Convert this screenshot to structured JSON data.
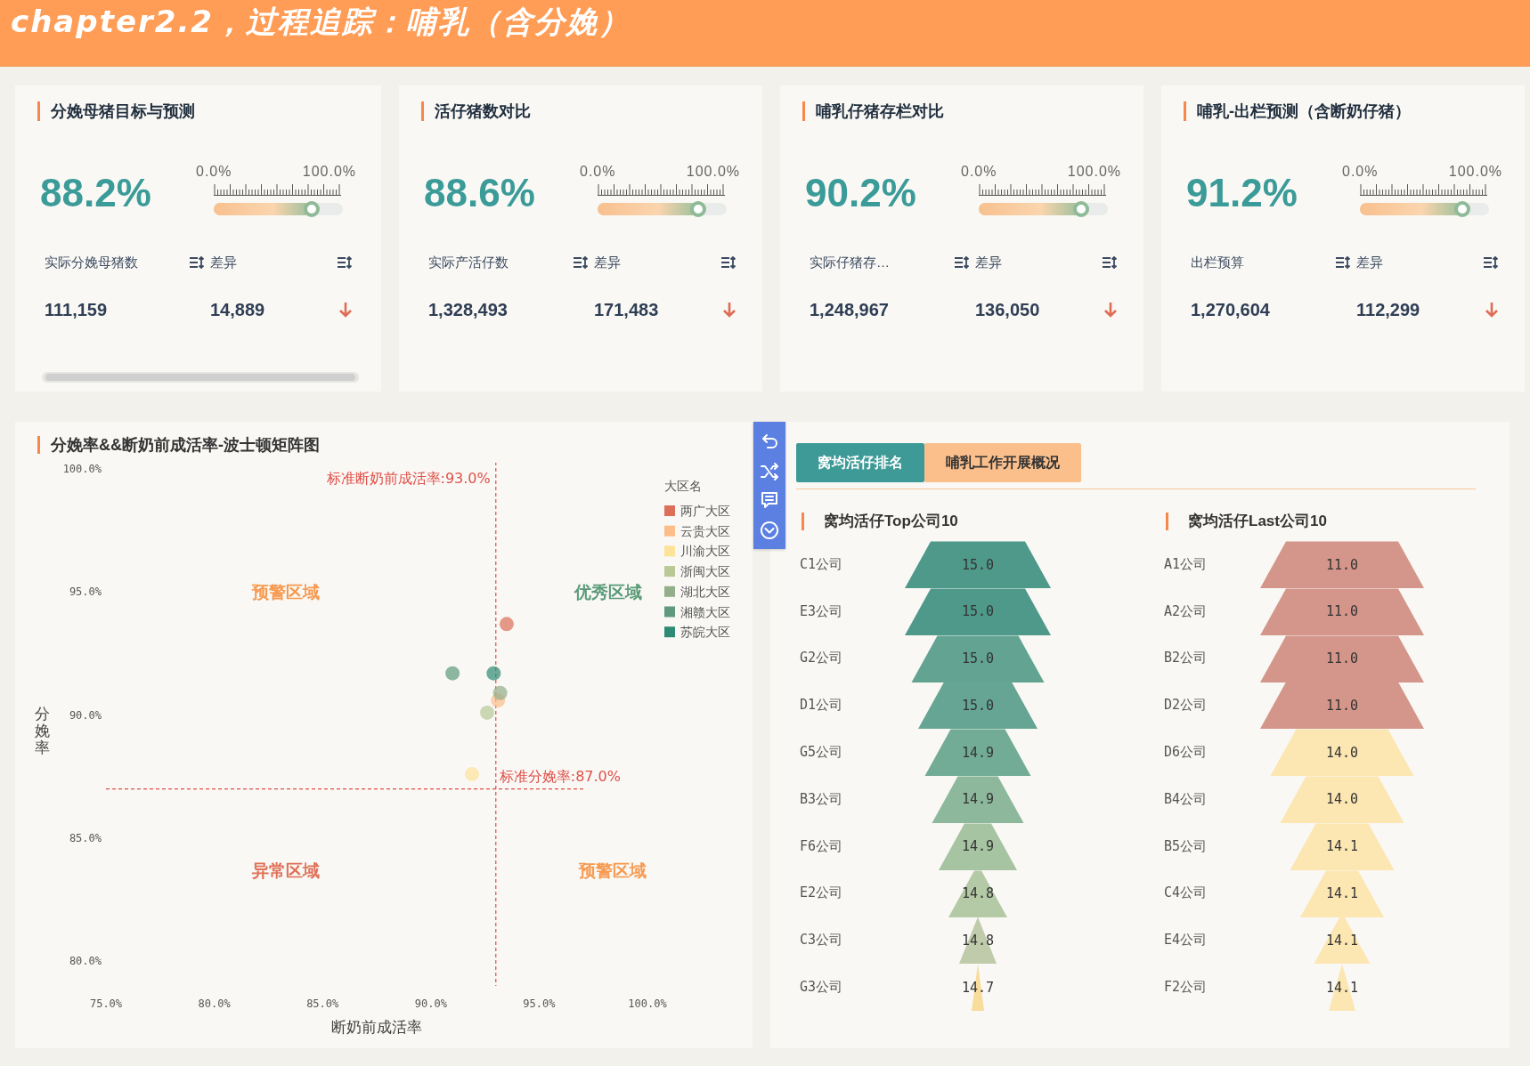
{
  "header": {
    "title": "chapter2.2，过程追踪：哺乳（含分娩）"
  },
  "kpi_cards": [
    {
      "title": "分娩母猪目标与预测",
      "rate": "88.2%",
      "slider": {
        "min_label": "0.0%",
        "max_label": "100.0%",
        "level": 0.76
      },
      "columns": [
        {
          "header": "实际分娩母猪数",
          "value": "111,159"
        },
        {
          "header": "差异",
          "value": "14,889"
        }
      ],
      "scrollbar": true
    },
    {
      "title": "活仔猪数对比",
      "rate": "88.6%",
      "slider": {
        "min_label": "0.0%",
        "max_label": "100.0%",
        "level": 0.78
      },
      "columns": [
        {
          "header": "实际产活仔数",
          "value": "1,328,493"
        },
        {
          "header": "差异",
          "value": "171,483"
        }
      ]
    },
    {
      "title": "哺乳仔猪存栏对比",
      "rate": "90.2%",
      "slider": {
        "min_label": "0.0%",
        "max_label": "100.0%",
        "level": 0.79
      },
      "columns": [
        {
          "header": "实际仔猪存…",
          "value": "1,248,967"
        },
        {
          "header": "差异",
          "value": "136,050"
        }
      ]
    },
    {
      "title": "哺乳-出栏预测（含断奶仔猪）",
      "rate": "91.2%",
      "slider": {
        "min_label": "0.0%",
        "max_label": "100.0%",
        "level": 0.79
      },
      "columns": [
        {
          "header": "出栏预算",
          "value": "1,270,604"
        },
        {
          "header": "差异",
          "value": "112,299"
        }
      ]
    }
  ],
  "boston_matrix": {
    "title": "分娩率&&断奶前成活率-波士顿矩阵图",
    "chart_data": {
      "type": "scatter",
      "xlabel": "断奶前成活率",
      "ylabel": "分娩率",
      "xlim": [
        75,
        100
      ],
      "ylim": [
        79,
        100
      ],
      "xticks": [
        {
          "value": 75,
          "label": "75.0%"
        },
        {
          "value": 80,
          "label": "80.0%"
        },
        {
          "value": 85,
          "label": "85.0%"
        },
        {
          "value": 90,
          "label": "90.0%"
        },
        {
          "value": 95,
          "label": "95.0%"
        },
        {
          "value": 100,
          "label": "100.0%"
        }
      ],
      "yticks": [
        {
          "value": 80,
          "label": "80.0%"
        },
        {
          "value": 85,
          "label": "85.0%"
        },
        {
          "value": 90,
          "label": "90.0%"
        },
        {
          "value": 95,
          "label": "95.0%"
        },
        {
          "value": 100,
          "label": "100.0%"
        }
      ],
      "legend_title": "大区名",
      "series": [
        {
          "name": "两广大区",
          "color": "#dd6e5a",
          "x": [
            93.5
          ],
          "values": [
            93.7
          ]
        },
        {
          "name": "云贵大区",
          "color": "#fbbd8a",
          "x": [
            93.1
          ],
          "values": [
            90.6
          ]
        },
        {
          "name": "川渝大区",
          "color": "#fde29a",
          "x": [
            91.9
          ],
          "values": [
            87.6
          ]
        },
        {
          "name": "浙闽大区",
          "color": "#b8c995",
          "x": [
            92.6
          ],
          "values": [
            90.1
          ]
        },
        {
          "name": "湖北大区",
          "color": "#93ae8a",
          "x": [
            93.2
          ],
          "values": [
            90.9
          ]
        },
        {
          "name": "湘赣大区",
          "color": "#5f9a7e",
          "x": [
            91.0
          ],
          "values": [
            91.7
          ]
        },
        {
          "name": "苏皖大区",
          "color": "#2f8a74",
          "x": [
            92.9
          ],
          "values": [
            91.7
          ]
        }
      ],
      "legend": "upper right",
      "ref_lines": [
        {
          "axis": "x",
          "value": 93,
          "label": "标准断奶前成活率:93.0%"
        },
        {
          "axis": "y",
          "value": 87,
          "label": "标准分娩率:87.0%"
        }
      ]
    },
    "quadrant_labels": [
      {
        "text": "预警区域",
        "color": "#f7994f"
      },
      {
        "text": "优秀区域",
        "color": "#5a9a78"
      },
      {
        "text": "异常区域",
        "color": "#e07058"
      },
      {
        "text": "预警区域",
        "color": "#f7994f"
      }
    ]
  },
  "ranking_panel": {
    "tabs": [
      {
        "label": "窝均活仔排名",
        "selected": true
      },
      {
        "label": "哺乳工作开展概况",
        "selected": false
      }
    ],
    "rankings": [
      {
        "title": "窝均活仔Top公司10",
        "items": [
          {
            "name": "C1公司",
            "value": "15.0",
            "color": "#4f998b"
          },
          {
            "name": "E3公司",
            "value": "15.0",
            "color": "#4f998b"
          },
          {
            "name": "G2公司",
            "value": "15.0",
            "color": "#62a392"
          },
          {
            "name": "D1公司",
            "value": "15.0",
            "color": "#66a593"
          },
          {
            "name": "G5公司",
            "value": "14.9",
            "color": "#73ac96"
          },
          {
            "name": "B3公司",
            "value": "14.9",
            "color": "#8db89b"
          },
          {
            "name": "F6公司",
            "value": "14.9",
            "color": "#a6c3a2"
          },
          {
            "name": "E2公司",
            "value": "14.8",
            "color": "#b4c9a6"
          },
          {
            "name": "C3公司",
            "value": "14.8",
            "color": "#bfcbab"
          },
          {
            "name": "G3公司",
            "value": "14.7",
            "color": "#f7dc9c"
          }
        ]
      },
      {
        "title": "窝均活仔Last公司10",
        "items": [
          {
            "name": "A1公司",
            "value": "11.0",
            "color": "#d4968a"
          },
          {
            "name": "A2公司",
            "value": "11.0",
            "color": "#d4968a"
          },
          {
            "name": "B2公司",
            "value": "11.0",
            "color": "#d4968a"
          },
          {
            "name": "D2公司",
            "value": "11.0",
            "color": "#d4968a"
          },
          {
            "name": "D6公司",
            "value": "14.0",
            "color": "#fce6b2"
          },
          {
            "name": "B4公司",
            "value": "14.0",
            "color": "#fce6b2"
          },
          {
            "name": "B5公司",
            "value": "14.1",
            "color": "#fce6b2"
          },
          {
            "name": "C4公司",
            "value": "14.1",
            "color": "#fce6b2"
          },
          {
            "name": "E4公司",
            "value": "14.1",
            "color": "#fce6b2"
          },
          {
            "name": "F2公司",
            "value": "14.1",
            "color": "#fce6b2"
          }
        ]
      }
    ]
  }
}
